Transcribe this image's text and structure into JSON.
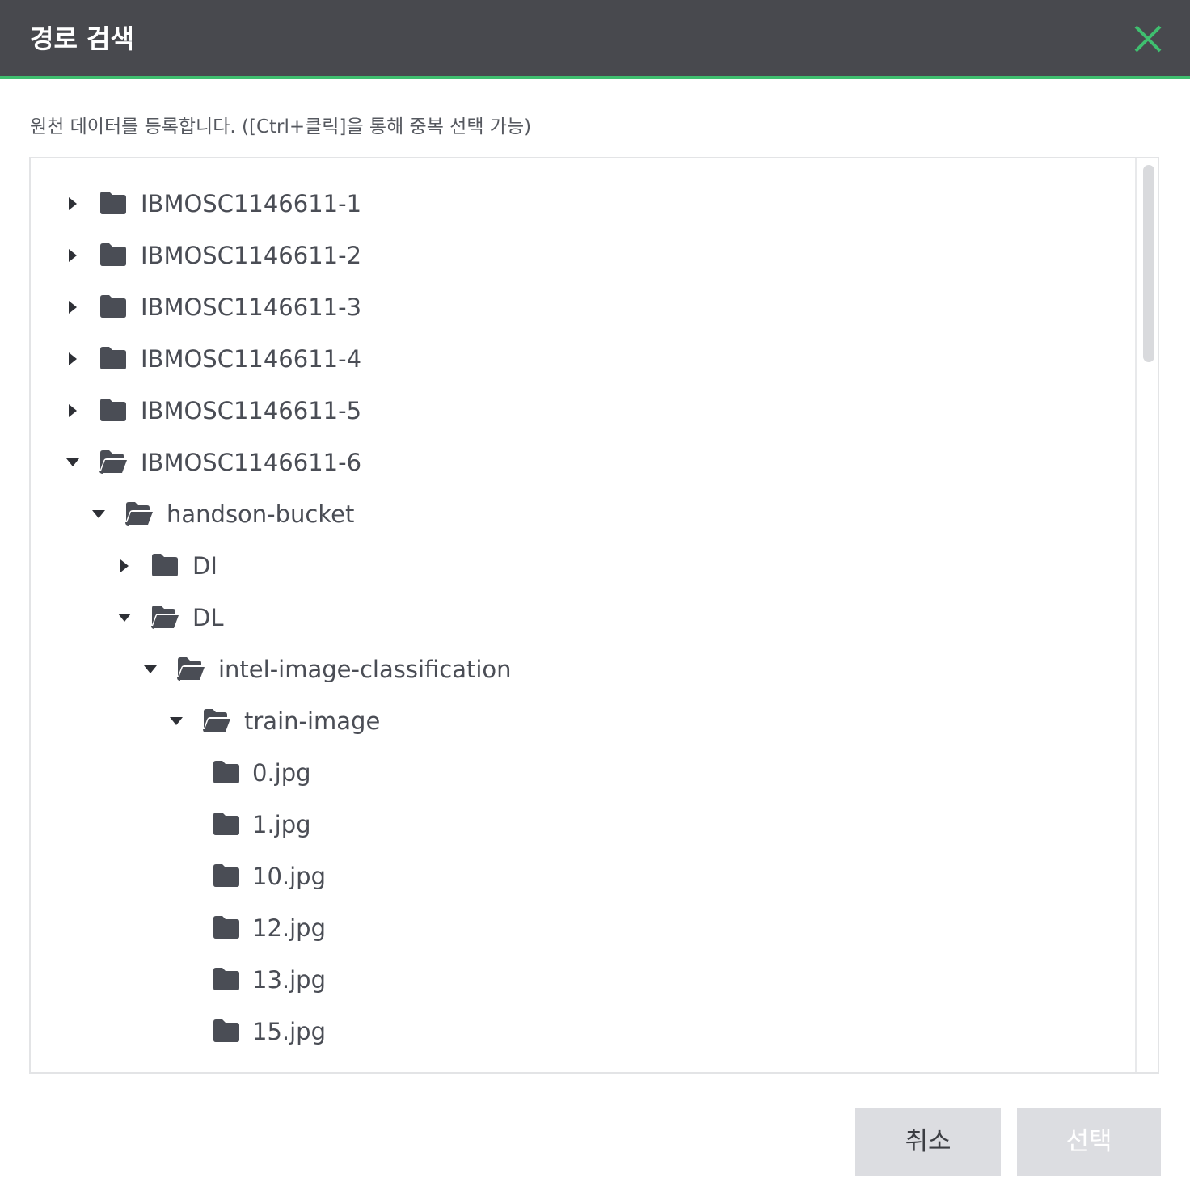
{
  "dialog": {
    "title": "경로 검색",
    "accent_color": "#3fbf6f",
    "header_color": "#48494e"
  },
  "description": "원천 데이터를 등록합니다. ([Ctrl+클릭]을 통해 중복 선택 가능)",
  "tree": {
    "nodes": [
      {
        "label": "IBMOSC1146611-1",
        "depth": 0,
        "expanded": false,
        "icon": "folder-icon"
      },
      {
        "label": "IBMOSC1146611-2",
        "depth": 0,
        "expanded": false,
        "icon": "folder-icon"
      },
      {
        "label": "IBMOSC1146611-3",
        "depth": 0,
        "expanded": false,
        "icon": "folder-icon"
      },
      {
        "label": "IBMOSC1146611-4",
        "depth": 0,
        "expanded": false,
        "icon": "folder-icon"
      },
      {
        "label": "IBMOSC1146611-5",
        "depth": 0,
        "expanded": false,
        "icon": "folder-icon"
      },
      {
        "label": "IBMOSC1146611-6",
        "depth": 0,
        "expanded": true,
        "icon": "folder-open-icon"
      },
      {
        "label": "handson-bucket",
        "depth": 1,
        "expanded": true,
        "icon": "folder-open-icon"
      },
      {
        "label": "DI",
        "depth": 2,
        "expanded": false,
        "icon": "folder-icon"
      },
      {
        "label": "DL",
        "depth": 2,
        "expanded": true,
        "icon": "folder-open-icon"
      },
      {
        "label": "intel-image-classification",
        "depth": 3,
        "expanded": true,
        "icon": "folder-open-icon"
      },
      {
        "label": "train-image",
        "depth": 4,
        "expanded": true,
        "icon": "folder-open-icon"
      },
      {
        "label": "0.jpg",
        "depth": 5,
        "leaf": true,
        "icon": "folder-icon"
      },
      {
        "label": "1.jpg",
        "depth": 5,
        "leaf": true,
        "icon": "folder-icon"
      },
      {
        "label": "10.jpg",
        "depth": 5,
        "leaf": true,
        "icon": "folder-icon"
      },
      {
        "label": "12.jpg",
        "depth": 5,
        "leaf": true,
        "icon": "folder-icon"
      },
      {
        "label": "13.jpg",
        "depth": 5,
        "leaf": true,
        "icon": "folder-icon"
      },
      {
        "label": "15.jpg",
        "depth": 5,
        "leaf": true,
        "icon": "folder-icon"
      }
    ]
  },
  "buttons": {
    "cancel_label": "취소",
    "select_label": "선택"
  }
}
